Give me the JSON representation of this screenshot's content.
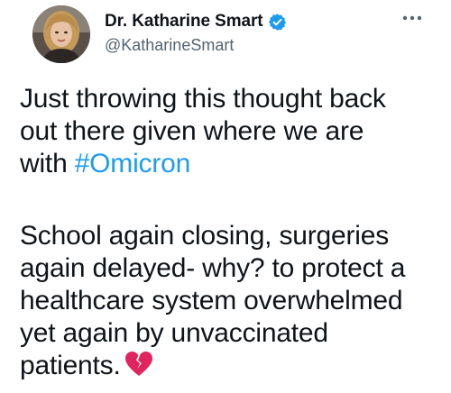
{
  "author": {
    "display_name": "Dr. Katharine Smart",
    "handle": "@KatharineSmart",
    "verified": true,
    "avatar_icon": "profile-photo"
  },
  "menu": {
    "icon": "more-options-icon"
  },
  "tweet": {
    "paragraph1": {
      "line1": "Just throwing this thought back",
      "line2": "out there given where we are",
      "line3_prefix": "with ",
      "hashtag": "#Omicron"
    },
    "paragraph2": {
      "line1": "School again closing, surgeries",
      "line2": "again delayed- why? to protect a",
      "line3": "healthcare system overwhelmed",
      "line4": "yet again by unvaccinated",
      "line5": "patients."
    },
    "emoji_icon": "broken-heart-icon"
  },
  "colors": {
    "text": "#0f1419",
    "secondary_text": "#536471",
    "link": "#1d9bf0",
    "verified_badge": "#1d9bf0",
    "broken_heart": "#e0245e"
  }
}
